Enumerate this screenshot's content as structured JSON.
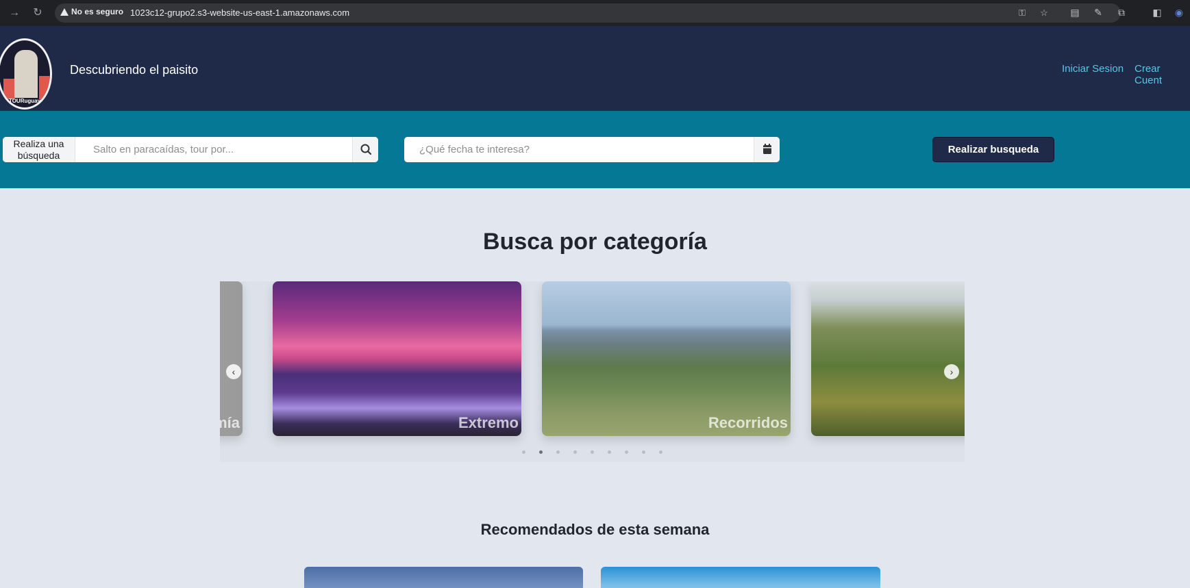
{
  "browser": {
    "security_label": "No es seguro",
    "url": "1023c12-grupo2.s3-website-us-east-1.amazonaws.com",
    "icons": [
      "forward-icon",
      "reload-icon",
      "key-icon",
      "star-icon",
      "extension-icon",
      "pen-icon",
      "puzzle-icon",
      "sidepanel-icon"
    ]
  },
  "header": {
    "logo_text": "TOURuguay",
    "title": "Descubriendo el paisito",
    "login_label": "Iniciar Sesion",
    "signup_label": "Crear Cuent"
  },
  "search": {
    "label": "Realiza una búsqueda",
    "placeholder": "Salto en paracaídas, tour por...",
    "date_placeholder": "¿Qué fecha te interesa?",
    "submit_label": "Realizar busqueda"
  },
  "categories": {
    "title": "Busca por categoría",
    "cards": [
      {
        "label": "omía"
      },
      {
        "label": "Extremo"
      },
      {
        "label": "Recorridos"
      },
      {
        "label": ""
      }
    ],
    "dots_total": 9,
    "active_dot": 1
  },
  "recommended": {
    "title": "Recomendados de esta semana"
  },
  "colors": {
    "header_bg": "#1e2a47",
    "search_band": "#047895",
    "page_bg": "#e2e7ef",
    "link": "#5bc6e8"
  }
}
